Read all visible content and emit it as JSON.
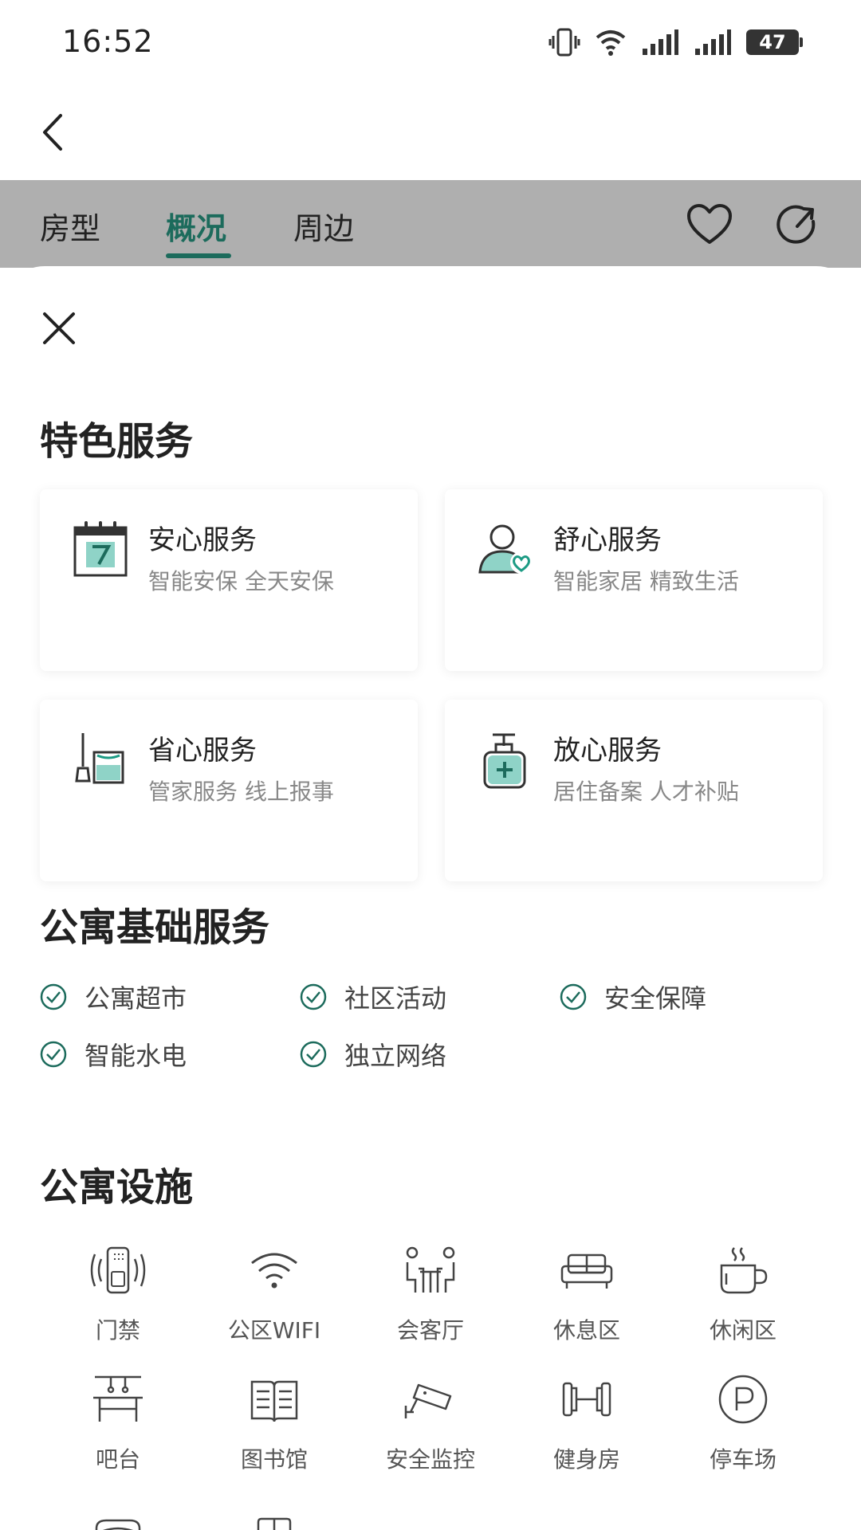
{
  "status_bar": {
    "time": "16:52",
    "battery": "47",
    "icons": [
      "vibrate-icon",
      "wifi-icon",
      "signal-1-icon",
      "signal-2-icon",
      "battery-icon"
    ]
  },
  "nav": {
    "back_icon": "chevron-left-icon"
  },
  "tabs": [
    {
      "label": "房型",
      "active": false
    },
    {
      "label": "概况",
      "active": true
    },
    {
      "label": "周边",
      "active": false
    }
  ],
  "tab_actions": [
    "heart-icon",
    "share-icon"
  ],
  "sheet": {
    "close_icon": "close-icon",
    "featured_title": "特色服务",
    "featured": [
      {
        "title": "安心服务",
        "sub": "智能安保 全天安保",
        "icon": "calendar-icon"
      },
      {
        "title": "舒心服务",
        "sub": "智能家居 精致生活",
        "icon": "user-heart-icon"
      },
      {
        "title": "省心服务",
        "sub": "管家服务 线上报事",
        "icon": "cleaning-icon"
      },
      {
        "title": "放心服务",
        "sub": "居住备案 人才补贴",
        "icon": "medical-bottle-icon"
      }
    ],
    "basic_title": "公寓基础服务",
    "basic": [
      "公寓超市",
      "社区活动",
      "安全保障",
      "智能水电",
      "独立网络"
    ],
    "facilities_title": "公寓设施",
    "facilities": [
      {
        "label": "门禁",
        "icon": "access-card-icon"
      },
      {
        "label": "公区WIFI",
        "icon": "wifi-icon"
      },
      {
        "label": "会客厅",
        "icon": "meeting-icon"
      },
      {
        "label": "休息区",
        "icon": "sofa-icon"
      },
      {
        "label": "休闲区",
        "icon": "coffee-icon"
      },
      {
        "label": "吧台",
        "icon": "bar-counter-icon"
      },
      {
        "label": "图书馆",
        "icon": "book-icon"
      },
      {
        "label": "安全监控",
        "icon": "camera-icon"
      },
      {
        "label": "健身房",
        "icon": "dumbbell-icon"
      },
      {
        "label": "停车场",
        "icon": "parking-icon"
      }
    ],
    "accent_color": "#1c6b5c",
    "teal_light": "#8fd3c7"
  }
}
